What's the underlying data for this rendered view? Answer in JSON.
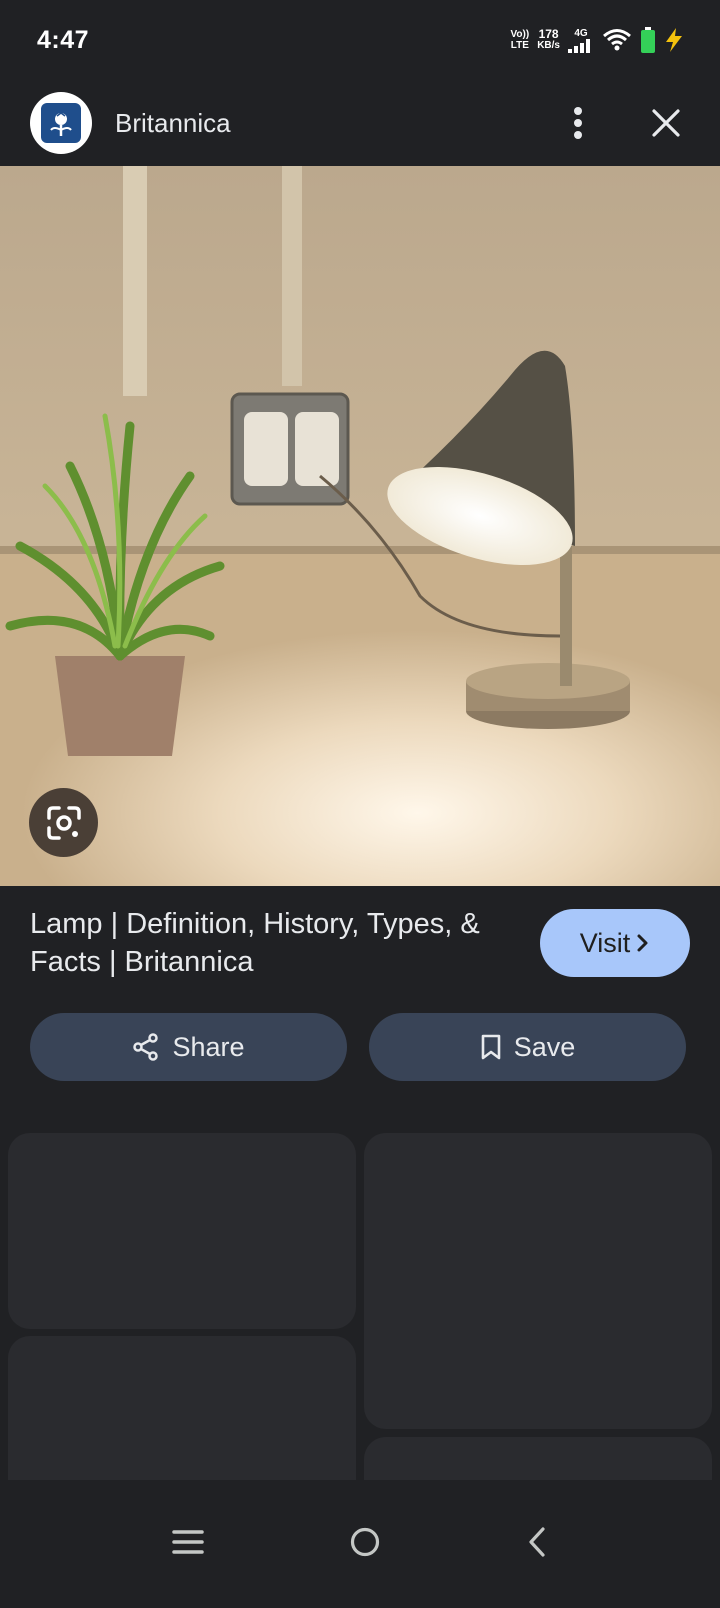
{
  "status_bar": {
    "time": "4:47",
    "volte_top": "Vo))",
    "volte_bottom": "LTE",
    "speed_value": "178",
    "speed_unit": "KB/s",
    "network": "4G",
    "icons": [
      "signal-icon",
      "wifi-icon",
      "battery-icon",
      "charging-icon"
    ]
  },
  "header": {
    "site_name": "Britannica",
    "logo": "britannica-thistle-logo",
    "menu_icon": "more-vert-icon",
    "close_icon": "close-icon"
  },
  "hero": {
    "image": "desk lamp on table with plant and wall outlet",
    "lens_icon": "google-lens-icon"
  },
  "result": {
    "title": "Lamp | Definition, History, Types, & Facts | Britannica",
    "visit_label": "Visit"
  },
  "actions": {
    "share_label": "Share",
    "save_label": "Save"
  },
  "colors": {
    "background": "#202124",
    "visit_button": "#a8c7fa",
    "action_button": "#394457",
    "card": "#2a2b2f"
  },
  "nav": {
    "icons": [
      "recents-icon",
      "home-icon",
      "back-icon"
    ]
  }
}
